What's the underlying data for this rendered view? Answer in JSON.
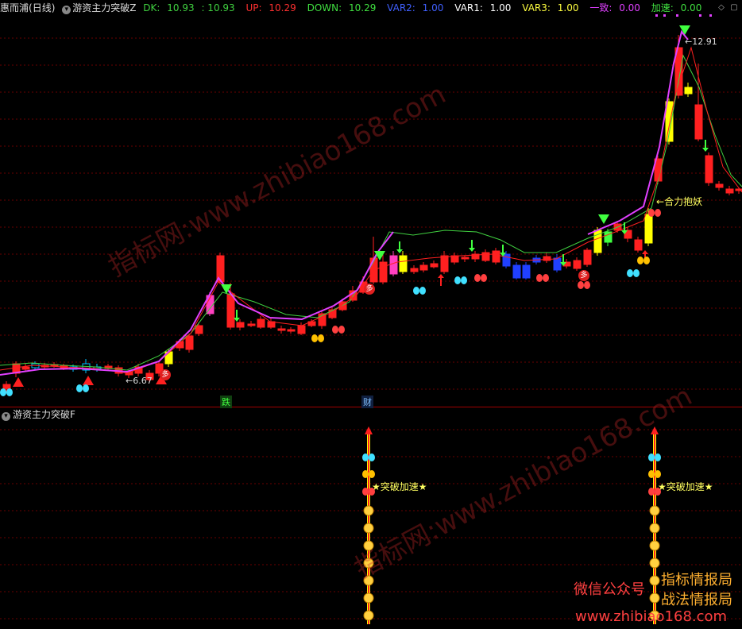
{
  "header": {
    "stock": "惠而浦",
    "period": "(日线)",
    "indicator": "游资主力突破Z",
    "dk_label": "DK:",
    "dk_val1": "10.93",
    "dk_val2": ": 10.93",
    "up_label": "UP:",
    "up_val": "10.29",
    "down_label": "DOWN:",
    "down_val": "10.29",
    "var2_label": "VAR2:",
    "var2_val": "1.00",
    "var1_label": "VAR1:",
    "var1_val": "1.00",
    "var3_label": "VAR3:",
    "var3_val": "1.00",
    "yizhi_label": "一致:",
    "yizhi_val": "0.00",
    "jiasu_label": "加速:",
    "jiasu_val": "0.00"
  },
  "sub_panel": {
    "title": "游资主力突破F",
    "label1": "★突破加速★",
    "label2": "★突破加速★"
  },
  "annotations": {
    "high_price": "12.91",
    "low_price": "6.67",
    "hot_label": "合力抱妖",
    "duo": "多",
    "die": "跌",
    "cai": "财"
  },
  "watermark": {
    "url": "www.zhibiao168.com",
    "site": "指标网:"
  },
  "branding": {
    "wechat": "微信公众号",
    "name1": "指标情报局",
    "name2": "战法情报局",
    "url": "www.zhibiao168.com"
  },
  "colors": {
    "up": "#ff2020",
    "down": "#00a0ff",
    "accent": "#e040ff",
    "ma": "#40d040",
    "yellow": "#ffff00"
  }
}
